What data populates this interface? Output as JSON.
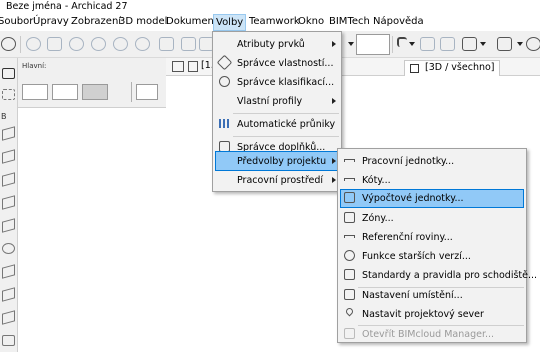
{
  "window": {
    "title": "Beze jména - Archicad 27"
  },
  "menubar": {
    "items": [
      "Soubor",
      "Úpravy",
      "Zobrazení",
      "3D model",
      "Dokument",
      "Volby",
      "Teamwork",
      "Okno",
      "BIMTech",
      "Nápověda"
    ],
    "active": "Volby"
  },
  "info_box": {
    "label": "Hlavní:"
  },
  "view_tabs": {
    "current_label": "[1.",
    "tab_3d": "[3D / všechno]"
  },
  "volby_menu": {
    "items": [
      {
        "label": "Atributy prvků",
        "submenu": true,
        "icon": ""
      },
      {
        "label": "Správce vlastností...",
        "submenu": false,
        "icon": "property-manager-icon"
      },
      {
        "label": "Správce klasifikací...",
        "submenu": false,
        "icon": "classification-manager-icon"
      },
      {
        "label": "Vlastní profily",
        "submenu": true,
        "icon": ""
      },
      {
        "label": "Automatické průniky",
        "submenu": false,
        "icon": "auto-intersection-icon"
      },
      {
        "label": "Správce doplňků...",
        "submenu": false,
        "icon": "addon-manager-icon"
      },
      {
        "label": "Předvolby projektu",
        "submenu": true,
        "icon": "",
        "highlighted": true
      },
      {
        "label": "Pracovní prostředí",
        "submenu": true,
        "icon": ""
      }
    ]
  },
  "predvolby_submenu": {
    "items": [
      {
        "label": "Pracovní jednotky...",
        "icon": "working-units-icon"
      },
      {
        "label": "Kóty...",
        "icon": "dimensions-icon"
      },
      {
        "label": "Výpočtové jednotky...",
        "icon": "calculation-units-icon",
        "highlighted": true
      },
      {
        "label": "Zóny...",
        "icon": "zones-icon"
      },
      {
        "label": "Referenční roviny...",
        "icon": "reference-levels-icon"
      },
      {
        "label": "Funkce starších verzí...",
        "icon": "legacy-icon"
      },
      {
        "label": "Standardy a pravidla pro schodiště...",
        "icon": "stair-rules-icon"
      },
      {
        "label": "Nastavení umístění...",
        "icon": "location-icon"
      },
      {
        "label": "Nastavit projektový sever",
        "icon": "project-north-icon"
      },
      {
        "label": "Otevřít BIMcloud Manager...",
        "icon": "bimcloud-icon",
        "disabled": true
      }
    ]
  }
}
